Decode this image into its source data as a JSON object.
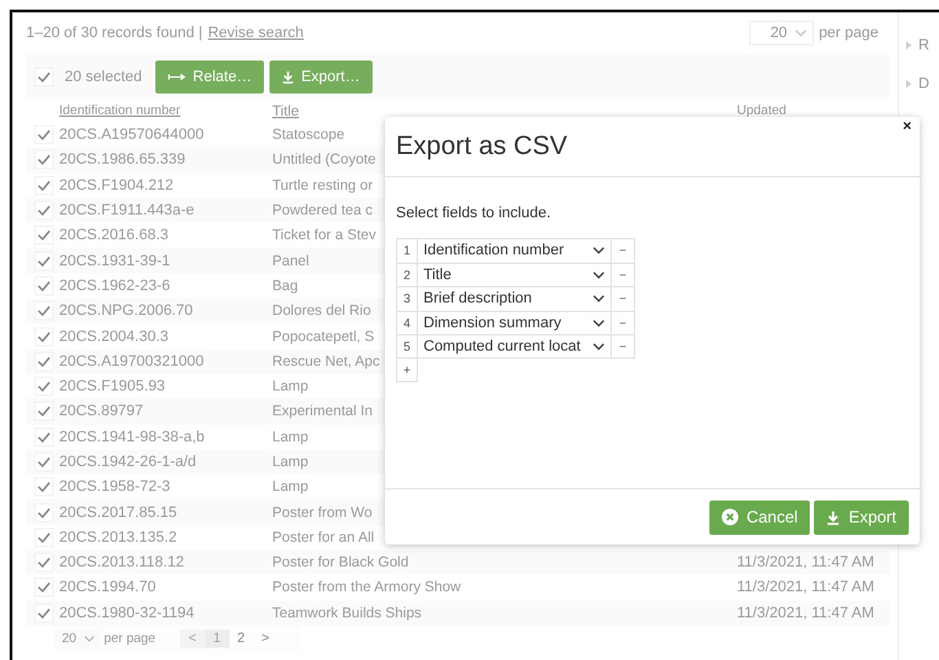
{
  "summary": {
    "text": "1–20 of 30 records found |",
    "link": "Revise search"
  },
  "page_size": {
    "value": "20",
    "unit": "per page"
  },
  "toolbar": {
    "select_all_checked": true,
    "selected_count": "20 selected",
    "buttons": [
      {
        "label": "Relate…",
        "kind": "relate"
      },
      {
        "label": "Export…",
        "kind": "export"
      }
    ]
  },
  "table": {
    "columns": [
      "Identification number",
      "Title",
      "Updated"
    ],
    "rows": [
      {
        "checked": true,
        "id": "20CS.A19570644000",
        "title": "Statoscope",
        "updated": ""
      },
      {
        "checked": true,
        "id": "20CS.1986.65.339",
        "title": "Untitled (Coyote",
        "updated": ""
      },
      {
        "checked": true,
        "id": "20CS.F1904.212",
        "title": "Turtle resting or",
        "updated": ""
      },
      {
        "checked": true,
        "id": "20CS.F1911.443a-e",
        "title": "Powdered tea c",
        "updated": ""
      },
      {
        "checked": true,
        "id": "20CS.2016.68.3",
        "title": "Ticket for a Stev",
        "updated": ""
      },
      {
        "checked": true,
        "id": "20CS.1931-39-1",
        "title": "Panel",
        "updated": ""
      },
      {
        "checked": true,
        "id": "20CS.1962-23-6",
        "title": "Bag",
        "updated": ""
      },
      {
        "checked": true,
        "id": "20CS.NPG.2006.70",
        "title": "Dolores del Rio",
        "updated": ""
      },
      {
        "checked": true,
        "id": "20CS.2004.30.3",
        "title": "Popocatepetl, S",
        "updated": ""
      },
      {
        "checked": true,
        "id": "20CS.A19700321000",
        "title": "Rescue Net, Apc",
        "updated": ""
      },
      {
        "checked": true,
        "id": "20CS.F1905.93",
        "title": "Lamp",
        "updated": ""
      },
      {
        "checked": true,
        "id": "20CS.89797",
        "title": "Experimental In",
        "updated": ""
      },
      {
        "checked": true,
        "id": "20CS.1941-98-38-a,b",
        "title": "Lamp",
        "updated": ""
      },
      {
        "checked": true,
        "id": "20CS.1942-26-1-a/d",
        "title": "Lamp",
        "updated": ""
      },
      {
        "checked": true,
        "id": "20CS.1958-72-3",
        "title": "Lamp",
        "updated": ""
      },
      {
        "checked": true,
        "id": "20CS.2017.85.15",
        "title": "Poster from Wo",
        "updated": ""
      },
      {
        "checked": true,
        "id": "20CS.2013.135.2",
        "title": "Poster for an All",
        "updated": ""
      },
      {
        "checked": true,
        "id": "20CS.2013.118.12",
        "title": "Poster for Black Gold",
        "updated": "11/3/2021, 11:47 AM"
      },
      {
        "checked": true,
        "id": "20CS.1994.70",
        "title": "Poster from the Armory Show",
        "updated": "11/3/2021, 11:47 AM"
      },
      {
        "checked": true,
        "id": "20CS.1980-32-1194",
        "title": "Teamwork Builds Ships",
        "updated": "11/3/2021, 11:47 AM"
      }
    ]
  },
  "pager": {
    "page_size": "20",
    "unit": "per page",
    "prev": "<",
    "next": ">",
    "pages": [
      {
        "label": "1",
        "selected": true
      },
      {
        "label": "2",
        "selected": false
      }
    ]
  },
  "sidebar": {
    "items": [
      {
        "label": "R"
      },
      {
        "label": "D"
      }
    ]
  },
  "dialog": {
    "title": "Export as CSV",
    "close": "×",
    "instruction": "Select fields to include.",
    "fields": [
      {
        "number": "1",
        "field": "Identification number"
      },
      {
        "number": "2",
        "field": "Title"
      },
      {
        "number": "3",
        "field": "Brief description"
      },
      {
        "number": "4",
        "field": "Dimension summary"
      },
      {
        "number": "5",
        "field": "Computed current locat"
      }
    ],
    "remove": "−",
    "add": "+",
    "buttons": [
      {
        "label": "Cancel",
        "kind": "cancel"
      },
      {
        "label": "Export",
        "kind": "export"
      }
    ]
  }
}
